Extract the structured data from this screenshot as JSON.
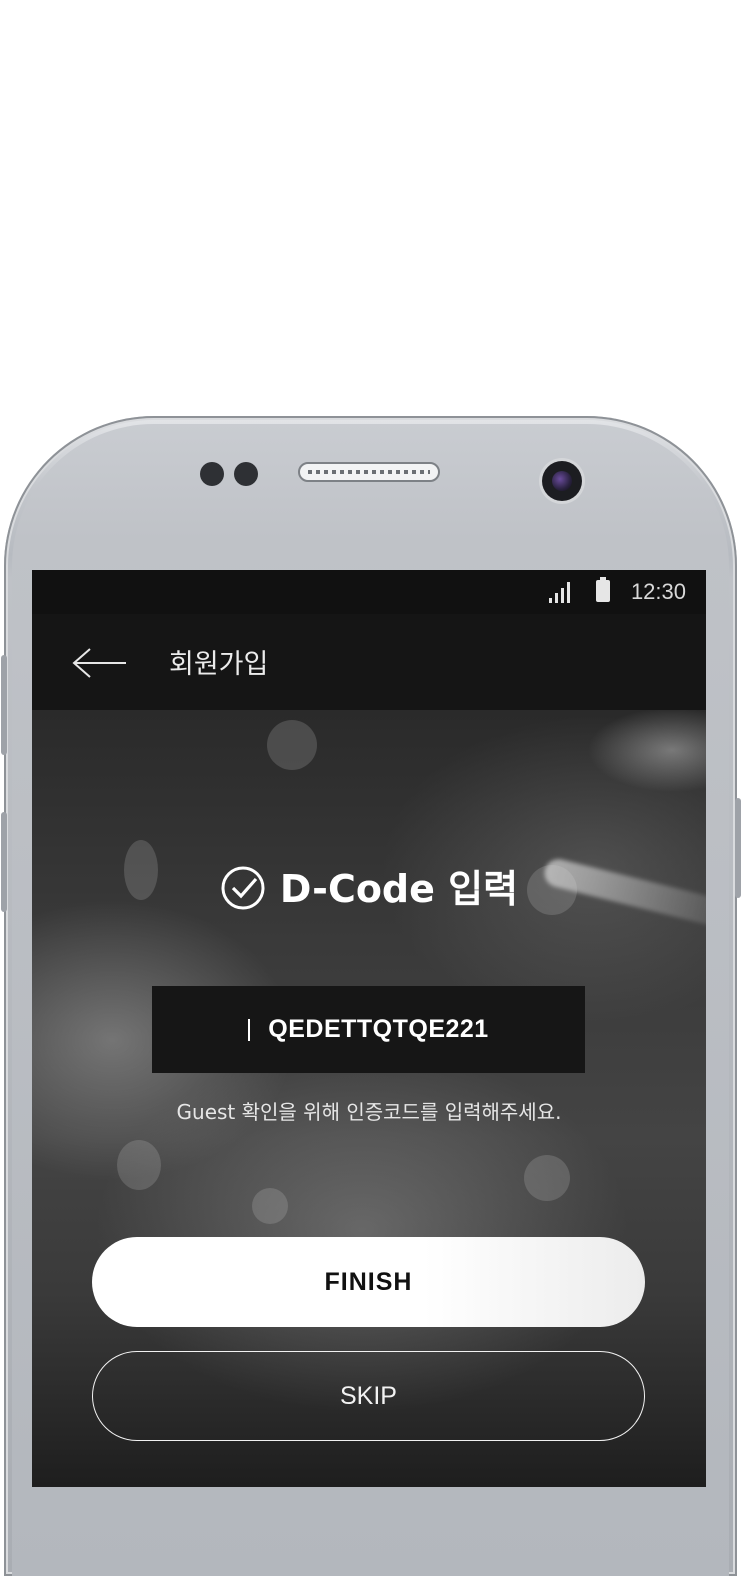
{
  "statusbar": {
    "time": "12:30",
    "icons": [
      "signal-icon",
      "battery-icon"
    ]
  },
  "appbar": {
    "back_icon": "arrow-left-icon",
    "title": "회원가입"
  },
  "content": {
    "heading_icon": "check-circle-icon",
    "heading": "D-Code 입력",
    "code_value": "QEDETTQTQE221",
    "helper_text": "Guest 확인을 위해 인증코드를 입력해주세요."
  },
  "actions": {
    "finish_label": "FINISH",
    "skip_label": "SKIP"
  },
  "colors": {
    "appbar_bg": "#151515",
    "primary_button_bg": "#ffffff",
    "text_light": "#ffffff"
  }
}
